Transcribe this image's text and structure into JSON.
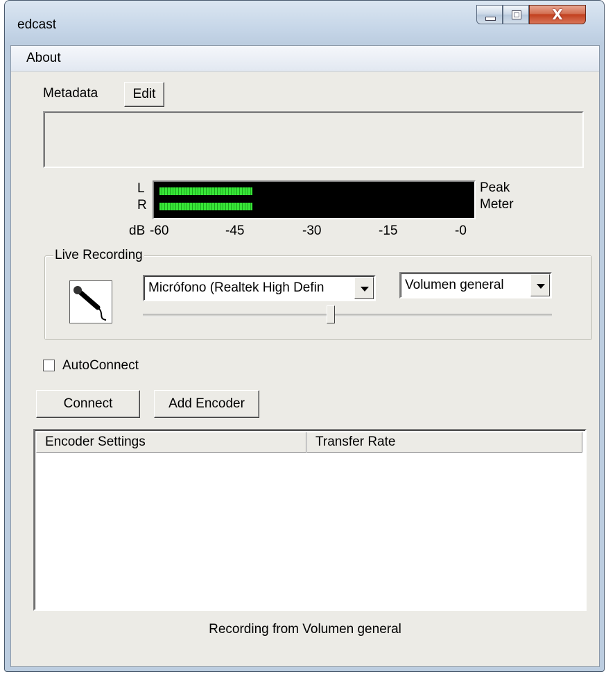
{
  "window": {
    "title": "edcast",
    "minimize_icon": "minimize-icon",
    "maximize_icon": "maximize-icon",
    "close_icon": "close-icon",
    "close_glyph": "X"
  },
  "menu": {
    "about": "About"
  },
  "metadata": {
    "label": "Metadata",
    "edit_button": "Edit",
    "text": ""
  },
  "peak_meter": {
    "left_label": "L",
    "right_label": "R",
    "title_line1": "Peak",
    "title_line2": "Meter",
    "db_label": "dB",
    "scale": [
      "-60",
      "-45",
      "-30",
      "-15",
      "-0"
    ],
    "left_level": -42,
    "right_level": -42,
    "bar_color": "#38e638"
  },
  "live_recording": {
    "legend": "Live Recording",
    "mic_icon": "microphone-icon",
    "device": "Micrófono (Realtek High Defin",
    "line": "Volumen general",
    "volume_percent": 50
  },
  "autoconnect": {
    "label": "AutoConnect",
    "checked": false
  },
  "buttons": {
    "connect": "Connect",
    "add_encoder": "Add Encoder"
  },
  "encoders": {
    "columns": [
      "Encoder Settings",
      "Transfer Rate"
    ],
    "rows": []
  },
  "status": "Recording from Volumen general"
}
